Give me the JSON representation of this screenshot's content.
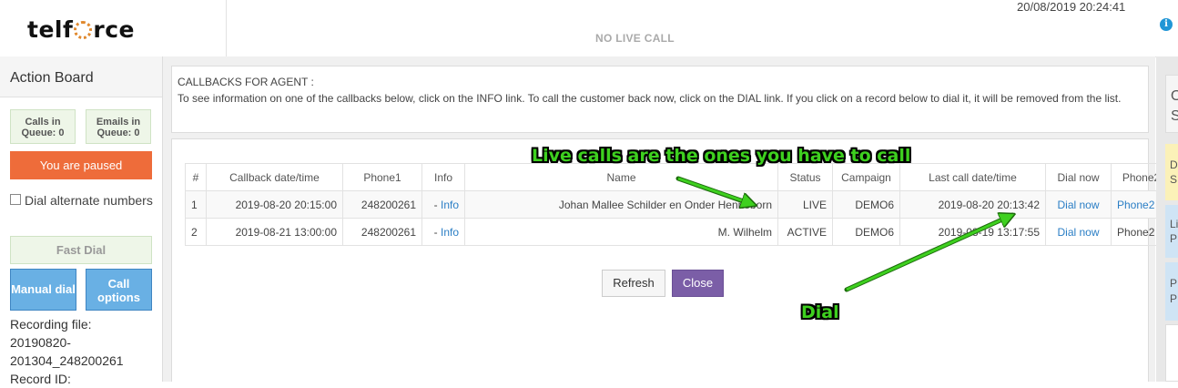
{
  "header": {
    "logo_text_pre": "telf",
    "logo_text_post": "rce",
    "live_status": "NO LIVE CALL",
    "datetime": "20/08/2019 20:24:41",
    "info_icon_glyph": "i"
  },
  "action_board": {
    "title": "Action Board",
    "calls_in_queue_label": "Calls in",
    "calls_in_queue_value": "Queue: 0",
    "emails_in_queue_label": "Emails in",
    "emails_in_queue_value": "Queue: 0",
    "paused_status": "You are paused",
    "dial_alternate_label": "Dial alternate numbers",
    "fast_dial_label": "Fast Dial",
    "manual_dial_label": "Manual dial",
    "call_options_label_1": "Call",
    "call_options_label_2": "options",
    "recording_file_label": "Recording file:",
    "recording_file_value_1": "20190820-",
    "recording_file_value_2": "201304_248200261",
    "record_id_label": "Record ID:"
  },
  "callbacks": {
    "heading": "CALLBACKS FOR AGENT :",
    "instructions": "To see information on one of the callbacks below, click on the INFO link. To call the customer back now, click on the DIAL link. If you click on a record below to dial it, it will be removed from the list.",
    "columns": [
      "#",
      "Callback date/time",
      "Phone1",
      "Info",
      "Name",
      "Status",
      "Campaign",
      "Last call date/time",
      "Dial now",
      "Phone2"
    ],
    "rows": [
      {
        "num": "1",
        "callback_datetime": "2019-08-20 20:15:00",
        "phone1": "248200261",
        "info_prefix": "- ",
        "info_link": "Info",
        "name": "Johan Mallee Schilder en Onder Henneborn",
        "status": "LIVE",
        "campaign": "DEMO6",
        "last_call": "2019-08-20 20:13:42",
        "dial_now": "Dial now",
        "phone2": "Phone2",
        "phone2_is_link": true
      },
      {
        "num": "2",
        "callback_datetime": "2019-08-21 13:00:00",
        "phone1": "248200261",
        "info_prefix": "- ",
        "info_link": "Info",
        "name": "M. Wilhelm",
        "status": "ACTIVE",
        "campaign": "DEMO6",
        "last_call": "2019-08-19 13:17:55",
        "dial_now": "Dial now",
        "phone2": "Phone2",
        "phone2_is_link": false
      }
    ],
    "refresh_label": "Refresh",
    "close_label": "Close"
  },
  "right_panel": {
    "card1_text_1": "O",
    "card1_text_2": "St",
    "yellow_text_1": "D",
    "yellow_text_2": "S",
    "blue1_text_1": "Li",
    "blue1_text_2": "P",
    "blue2_text_1": "P",
    "blue2_text_2": "P"
  },
  "annotations": {
    "live_calls_note": "Live calls are the ones you have to call",
    "dial_note": "Dial"
  },
  "colors": {
    "paused": "#ee6c3a",
    "close_button": "#7b5ea7",
    "link": "#2a7ec5",
    "annotation": "#3ed01f",
    "blue_button": "#69b0e4"
  }
}
